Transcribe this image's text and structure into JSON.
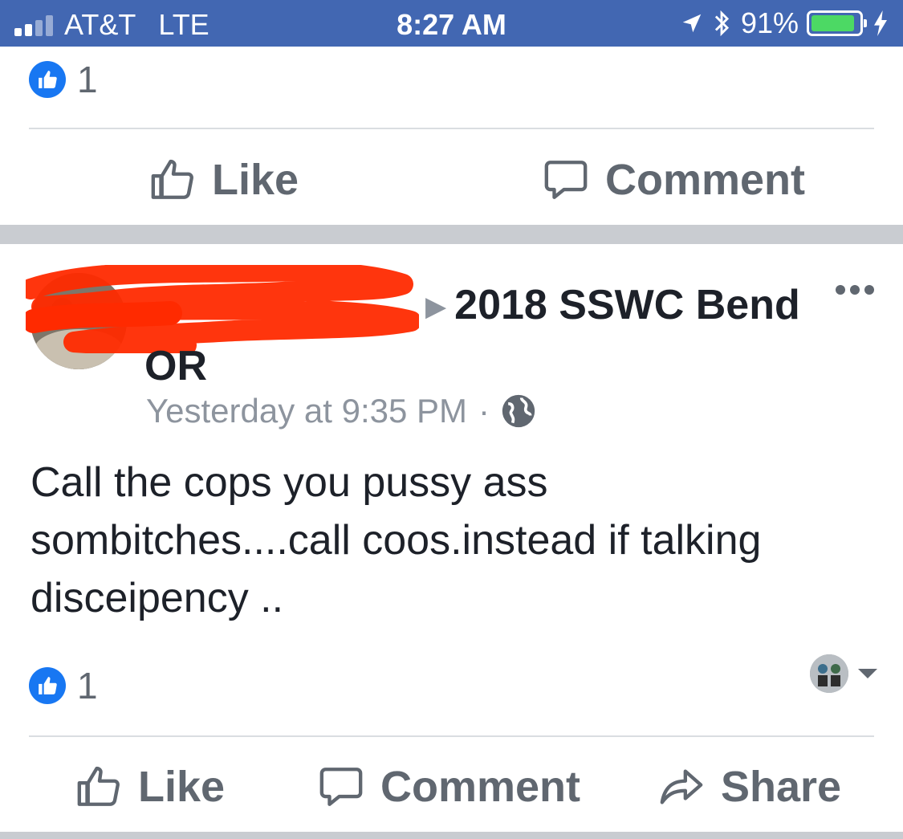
{
  "status_bar": {
    "carrier": "AT&T",
    "network": "LTE",
    "time": "8:27 AM",
    "battery_percent": "91%",
    "battery_level": 0.91,
    "icons": [
      "signal-icon",
      "location-arrow-icon",
      "bluetooth-icon",
      "battery-icon",
      "charging-bolt-icon"
    ]
  },
  "previous_post": {
    "like_count": "1",
    "actions": {
      "like": "Like",
      "comment": "Comment"
    }
  },
  "post": {
    "author_redacted": true,
    "group_name": "2018 SSWC Bend OR",
    "timestamp": "Yesterday at 9:35 PM",
    "separator": "·",
    "privacy_icon": "globe-icon",
    "body": "Call the cops you pussy ass sombitches....call coos.instead if talking disceipency ..",
    "like_count": "1",
    "actions": {
      "like": "Like",
      "comment": "Comment",
      "share": "Share"
    }
  },
  "colors": {
    "status_bar": "#4267b2",
    "like_blue": "#1877f2",
    "action_gray": "#606770",
    "meta_gray": "#8d949e",
    "separator_gray": "#c9ccd1",
    "redaction_red": "#ff2a00"
  }
}
